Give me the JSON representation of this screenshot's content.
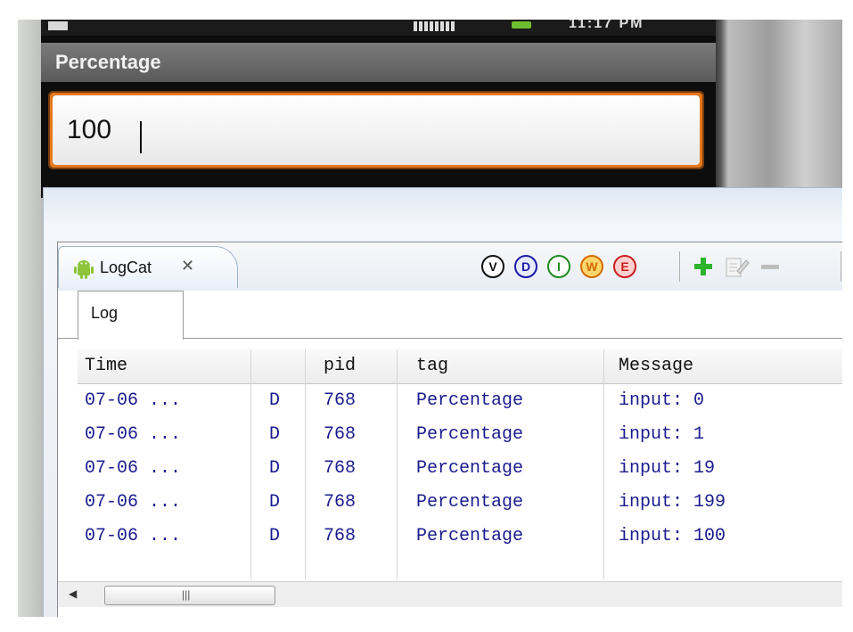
{
  "phone": {
    "status_time": "11:17 PM",
    "app_title": "Percentage",
    "input_value": "100"
  },
  "logcat": {
    "view_title": "LogCat",
    "log_tab": "Log",
    "filters": [
      {
        "letter": "V",
        "color": "#111111",
        "fill": "#ffffff"
      },
      {
        "letter": "D",
        "color": "#1a1aa8",
        "fill": "#e8ecff"
      },
      {
        "letter": "I",
        "color": "#1e8a1e",
        "fill": "#ffffff"
      },
      {
        "letter": "W",
        "color": "#d06b00",
        "fill": "#ffd66b"
      },
      {
        "letter": "E",
        "color": "#c81e1e",
        "fill": "#ffd0d0"
      }
    ],
    "accent_add": "#2cb52c",
    "columns": [
      "Time",
      "",
      "pid",
      "tag",
      "Message"
    ],
    "rows": [
      {
        "time": "07-06 ...",
        "level": "D",
        "pid": "768",
        "tag": "Percentage",
        "message": "input: 0"
      },
      {
        "time": "07-06 ...",
        "level": "D",
        "pid": "768",
        "tag": "Percentage",
        "message": "input: 1"
      },
      {
        "time": "07-06 ...",
        "level": "D",
        "pid": "768",
        "tag": "Percentage",
        "message": "input: 19"
      },
      {
        "time": "07-06 ...",
        "level": "D",
        "pid": "768",
        "tag": "Percentage",
        "message": "input: 199"
      },
      {
        "time": "07-06 ...",
        "level": "D",
        "pid": "768",
        "tag": "Percentage",
        "message": "input: 100"
      }
    ]
  }
}
